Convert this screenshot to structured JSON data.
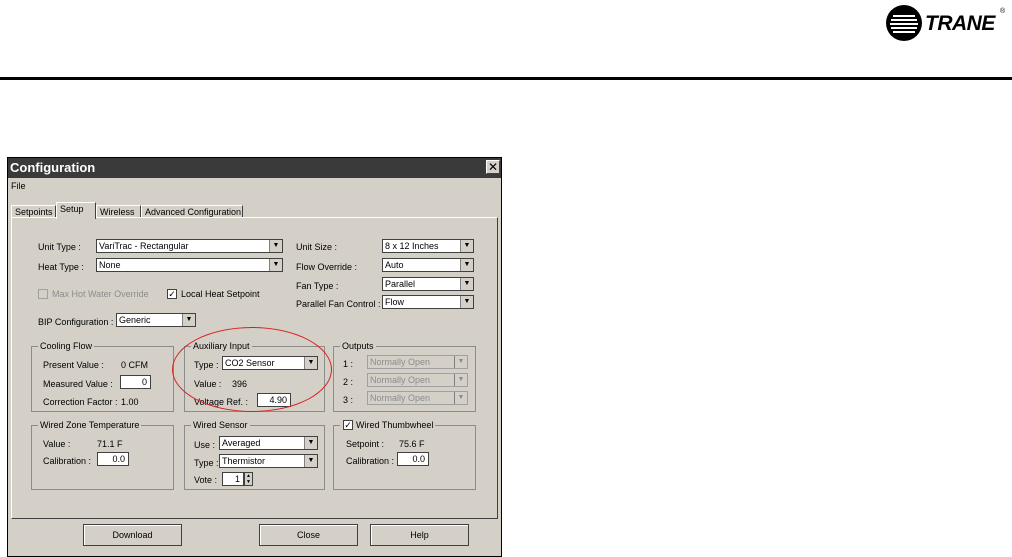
{
  "brand": {
    "name": "TRANE",
    "reg": "®"
  },
  "window": {
    "title": "Configuration",
    "close": "✕"
  },
  "menu": {
    "file": "File"
  },
  "tabs": [
    "Setpoints",
    "Setup",
    "Wireless",
    "Advanced Configuration"
  ],
  "setup": {
    "unit_type": {
      "label": "Unit Type :",
      "value": "VariTrac - Rectangular"
    },
    "heat_type": {
      "label": "Heat Type :",
      "value": "None"
    },
    "unit_size": {
      "label": "Unit Size :",
      "value": "8 x 12 Inches"
    },
    "flow_override": {
      "label": "Flow Override :",
      "value": "Auto"
    },
    "fan_type": {
      "label": "Fan Type :",
      "value": "Parallel"
    },
    "parallel_fan_control": {
      "label": "Parallel Fan Control :",
      "value": "Flow"
    },
    "max_hot_water_override": {
      "label": "Max Hot Water Override",
      "checked": false
    },
    "local_heat_setpoint": {
      "label": "Local Heat Setpoint",
      "checked": true
    },
    "bip_configuration": {
      "label": "BIP Configuration :",
      "value": "Generic"
    }
  },
  "cooling_flow": {
    "title": "Cooling Flow",
    "present_label": "Present Value :",
    "present_value": "0 CFM",
    "measured_label": "Measured Value :",
    "measured_value": "0",
    "correction_label": "Correction Factor :",
    "correction_value": "1.00"
  },
  "auxiliary_input": {
    "title": "Auxiliary Input",
    "type_label": "Type :",
    "type_value": "CO2 Sensor",
    "value_label": "Value :",
    "value_value": "396",
    "voltage_label": "Voltage Ref. :",
    "voltage_value": "4.90"
  },
  "outputs": {
    "title": "Outputs",
    "items": [
      {
        "label": "1 :",
        "value": "Normally Open"
      },
      {
        "label": "2 :",
        "value": "Normally Open"
      },
      {
        "label": "3 :",
        "value": "Normally Open"
      }
    ]
  },
  "wired_zone_temperature": {
    "title": "Wired Zone Temperature",
    "value_label": "Value :",
    "value_value": "71.1 F",
    "calibration_label": "Calibration :",
    "calibration_value": "0.0"
  },
  "wired_sensor": {
    "title": "Wired Sensor",
    "use_label": "Use :",
    "use_value": "Averaged",
    "type_label": "Type :",
    "type_value": "Thermistor",
    "vote_label": "Vote :",
    "vote_value": "1"
  },
  "wired_thumbwheel": {
    "title": "Wired Thumbwheel",
    "checked": true,
    "setpoint_label": "Setpoint :",
    "setpoint_value": "75.6 F",
    "calibration_label": "Calibration :",
    "calibration_value": "0.0"
  },
  "buttons": {
    "download": "Download",
    "close": "Close",
    "help": "Help"
  },
  "colors": {
    "titlebar": "#3a3a3a",
    "dialog_bg": "#d4d0c8",
    "highlight": "#d62020"
  }
}
